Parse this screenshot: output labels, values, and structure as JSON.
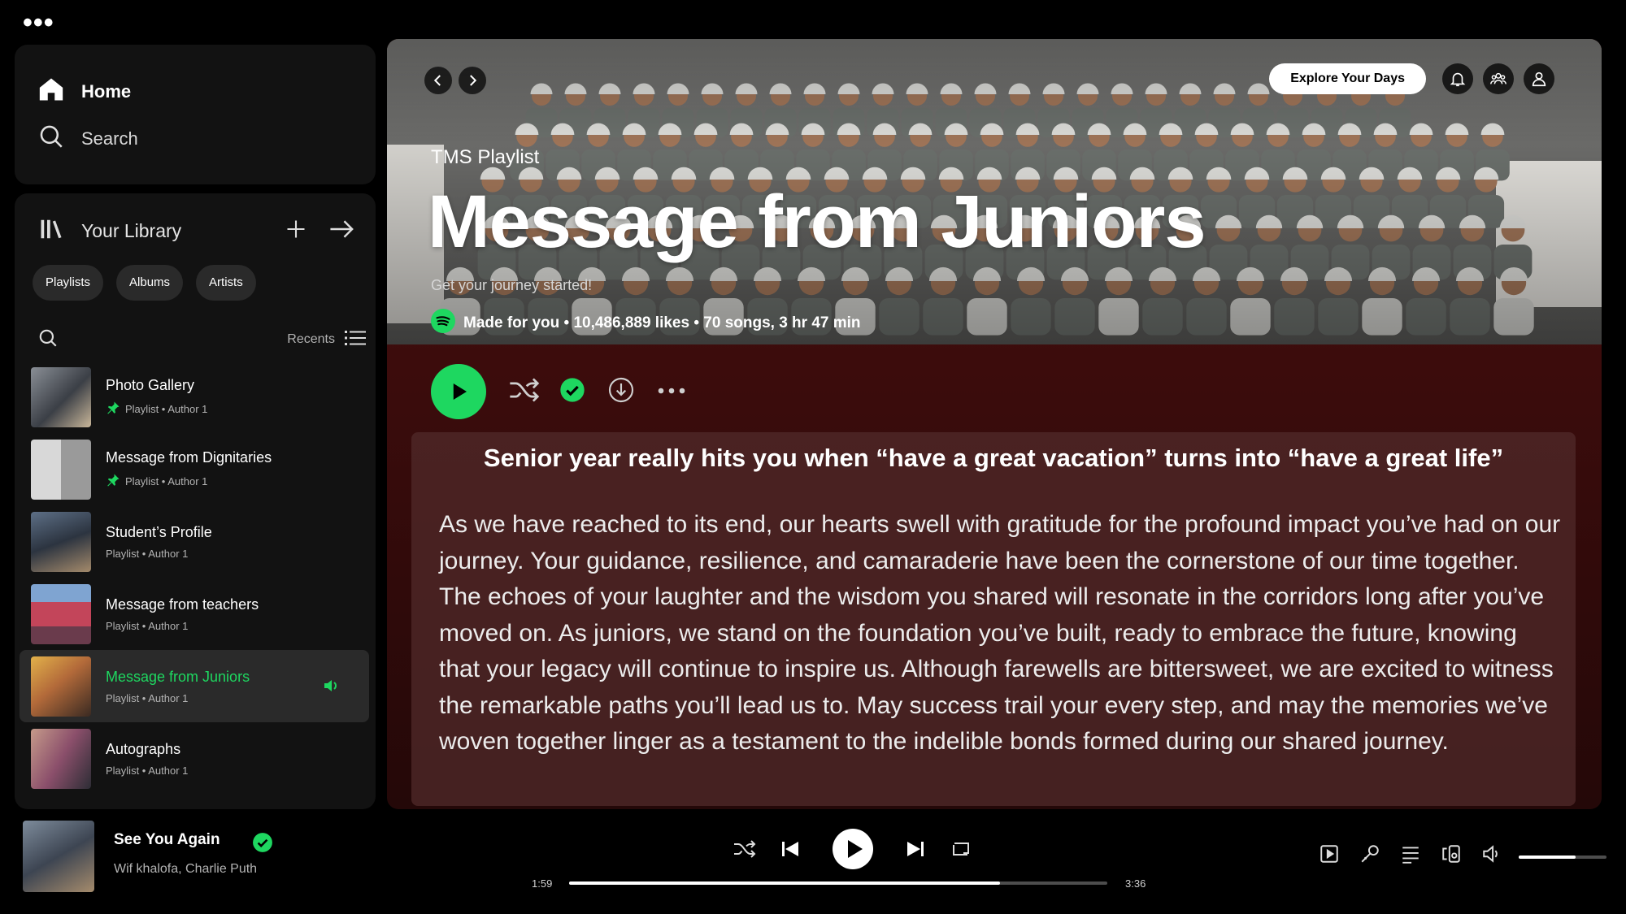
{
  "window": {
    "menu_dots": "•••"
  },
  "nav": {
    "home_label": "Home",
    "search_label": "Search"
  },
  "library": {
    "title": "Your Library",
    "chips": [
      "Playlists",
      "Albums",
      "Artists"
    ],
    "recents_label": "Recents",
    "items": [
      {
        "name": "Photo Gallery",
        "sub": "Playlist • Author 1",
        "pinned": true,
        "active": false
      },
      {
        "name": "Message from Dignitaries",
        "sub": "Playlist • Author 1",
        "pinned": true,
        "active": false
      },
      {
        "name": "Student’s Profile",
        "sub": "Playlist • Author 1",
        "pinned": false,
        "active": false
      },
      {
        "name": "Message from teachers",
        "sub": "Playlist • Author 1",
        "pinned": false,
        "active": false
      },
      {
        "name": "Message from Juniors",
        "sub": "Playlist • Author 1",
        "pinned": false,
        "active": true
      },
      {
        "name": "Autographs",
        "sub": "Playlist • Author 1",
        "pinned": false,
        "active": false
      }
    ]
  },
  "header": {
    "explore_label": "Explore Your Days"
  },
  "playlist": {
    "type": "TMS Playlist",
    "title": "Message from Juniors",
    "description": "Get your journey started!",
    "meta": "Made for you • 10,486,889 likes • 70 songs, 3 hr 47 min"
  },
  "message": {
    "heading": "Senior year really hits you when “have a great vacation” turns into “have a great life”",
    "body": "As we have reached to its end, our hearts swell with gratitude for the profound impact you’ve had on our journey. Your guidance, resilience, and camaraderie have been the cornerstone of our time together. The echoes of your laughter and the wisdom you shared will resonate in the corridors long after you’ve moved on. As juniors, we stand on the foundation you’ve built, ready to embrace the future, knowing that your legacy will continue to inspire us. Although farewells are bittersweet, we are excited to witness the remarkable paths you’ll lead us to. May success trail your every step, and may the memories we’ve woven together linger as a testament to the indelible bonds formed during our shared journey."
  },
  "player": {
    "track_title": "See You Again",
    "artists": "Wif khalofa, Charlie Puth",
    "elapsed": "1:59",
    "duration": "3:36",
    "progress": 0.8,
    "volume": 0.65
  },
  "colors": {
    "accent": "#1ed760",
    "panel": "#121212",
    "main_bg": "#3b0c0c"
  }
}
